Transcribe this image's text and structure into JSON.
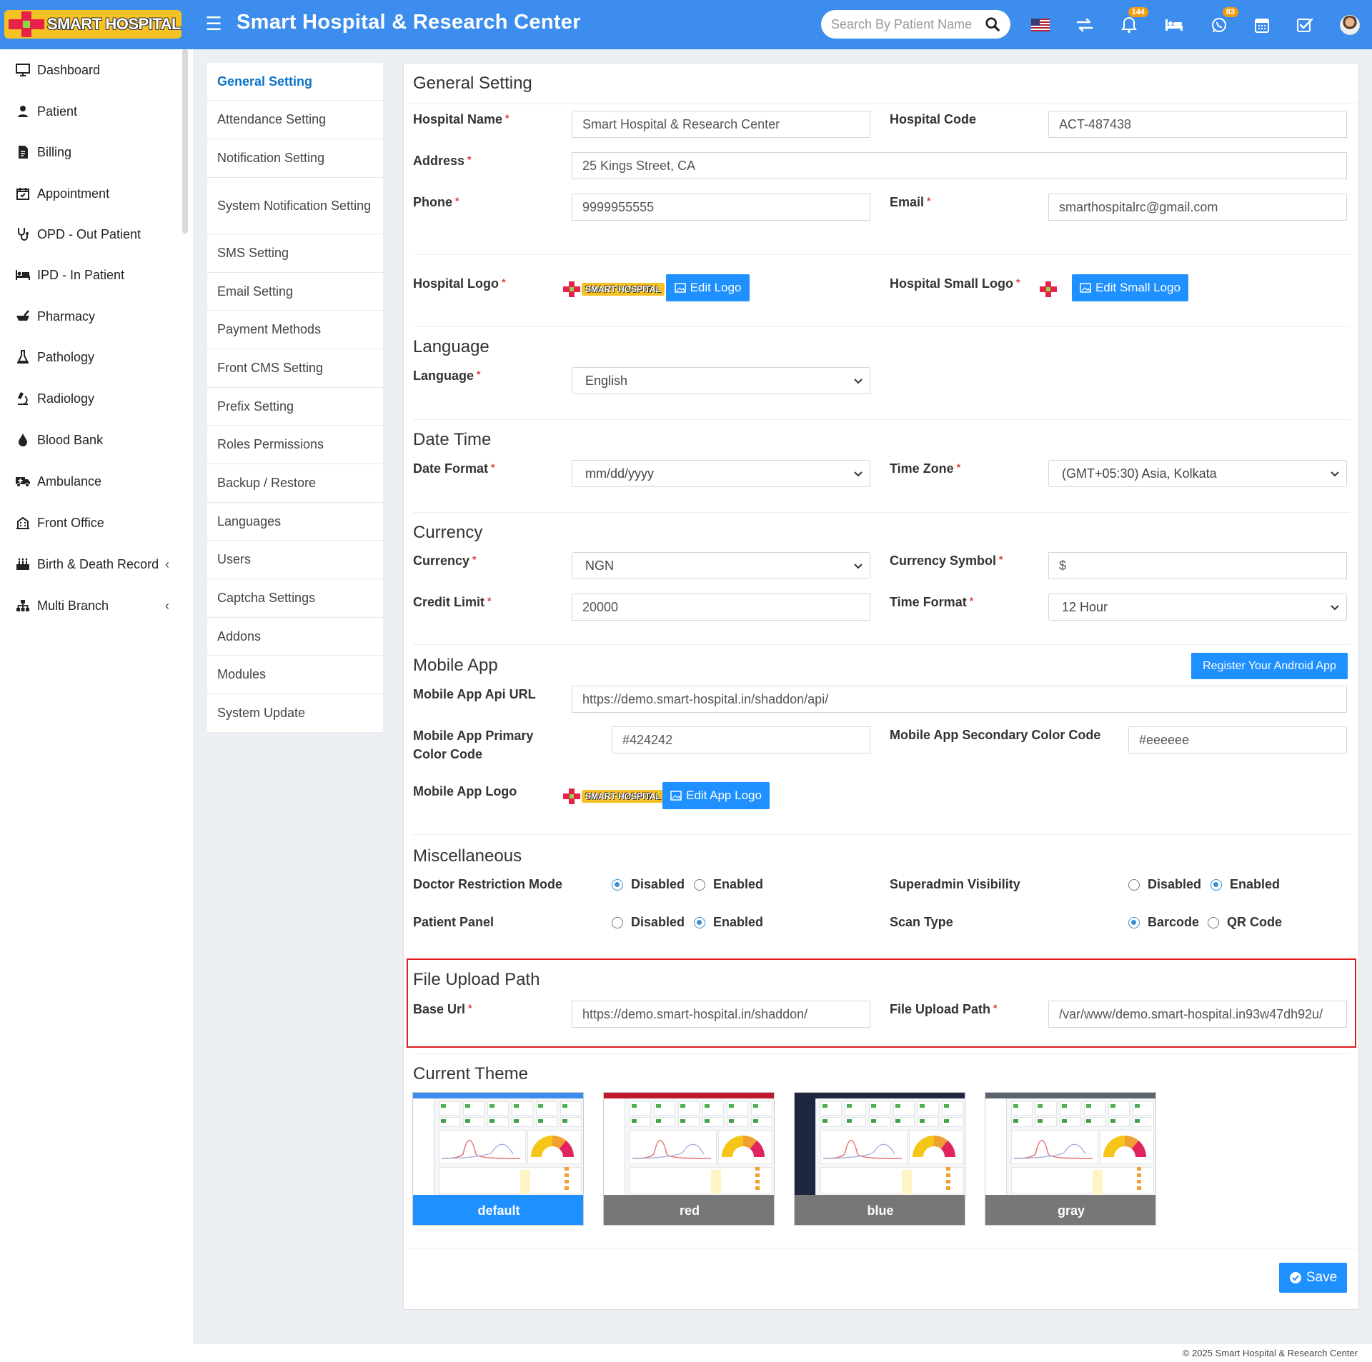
{
  "header": {
    "logo_text": "SMART HOSPITAL",
    "title": "Smart Hospital & Research Center",
    "search_placeholder": "Search By Patient Name",
    "notification_count": "144",
    "whatsapp_count": "83",
    "color": "#3c8dee"
  },
  "sidebar": {
    "items": [
      {
        "label": "Dashboard",
        "icon": "monitor-icon"
      },
      {
        "label": "Patient",
        "icon": "user-icon"
      },
      {
        "label": "Billing",
        "icon": "invoice-icon"
      },
      {
        "label": "Appointment",
        "icon": "calendar-check-icon"
      },
      {
        "label": "OPD - Out Patient",
        "icon": "stethoscope-icon"
      },
      {
        "label": "IPD - In Patient",
        "icon": "bed-icon"
      },
      {
        "label": "Pharmacy",
        "icon": "mortar-pestle-icon"
      },
      {
        "label": "Pathology",
        "icon": "flask-icon"
      },
      {
        "label": "Radiology",
        "icon": "microscope-icon"
      },
      {
        "label": "Blood Bank",
        "icon": "blood-drop-icon"
      },
      {
        "label": "Ambulance",
        "icon": "ambulance-icon"
      },
      {
        "label": "Front Office",
        "icon": "building-icon"
      },
      {
        "label": "Birth & Death Record",
        "icon": "birthday-cake-icon"
      },
      {
        "label": "Multi Branch",
        "icon": "sitemap-icon"
      }
    ]
  },
  "settings_menu": [
    "General Setting",
    "Attendance Setting",
    "Notification Setting",
    "System Notification Setting",
    "SMS Setting",
    "Email Setting",
    "Payment Methods",
    "Front CMS Setting",
    "Prefix Setting",
    "Roles Permissions",
    "Backup / Restore",
    "Languages",
    "Users",
    "Captcha Settings",
    "Addons",
    "Modules",
    "System Update"
  ],
  "form": {
    "title": "General Setting",
    "hospital_name_label": "Hospital Name",
    "hospital_name": "Smart Hospital & Research Center",
    "hospital_code_label": "Hospital Code",
    "hospital_code": "ACT-487438",
    "address_label": "Address",
    "address": "25 Kings Street, CA",
    "phone_label": "Phone",
    "phone": "9999955555",
    "email_label": "Email",
    "email": "smarthospitalrc@gmail.com",
    "hospital_logo_label": "Hospital Logo",
    "edit_logo": "Edit Logo",
    "small_logo_label": "Hospital Small Logo",
    "edit_small_logo": "Edit Small Logo",
    "language_section": "Language",
    "language_label": "Language",
    "language": "English",
    "datetime_section": "Date Time",
    "date_format_label": "Date Format",
    "date_format": "mm/dd/yyyy",
    "time_zone_label": "Time Zone",
    "time_zone": "(GMT+05:30) Asia, Kolkata",
    "currency_section": "Currency",
    "currency_label": "Currency",
    "currency": "NGN",
    "currency_symbol_label": "Currency Symbol",
    "currency_symbol": "$",
    "credit_limit_label": "Credit Limit",
    "credit_limit": "20000",
    "time_format_label": "Time Format",
    "time_format": "12 Hour",
    "mobile_section": "Mobile App",
    "register_app": "Register Your Android App",
    "api_url_label": "Mobile App Api URL",
    "api_url": "https://demo.smart-hospital.in/shaddon/api/",
    "primary_color_label": "Mobile App Primary Color Code",
    "primary_color": "#424242",
    "secondary_color_label": "Mobile App Secondary Color Code",
    "secondary_color": "#eeeeee",
    "app_logo_label": "Mobile App Logo",
    "edit_app_logo": "Edit App Logo",
    "misc_section": "Miscellaneous",
    "doctor_restriction_label": "Doctor Restriction Mode",
    "superadmin_visibility_label": "Superadmin Visibility",
    "patient_panel_label": "Patient Panel",
    "scan_type_label": "Scan Type",
    "disabled": "Disabled",
    "enabled": "Enabled",
    "barcode": "Barcode",
    "qrcode": "QR Code",
    "file_upload_section": "File Upload Path",
    "base_url_label": "Base Url",
    "base_url": "https://demo.smart-hospital.in/shaddon/",
    "file_upload_label": "File Upload Path",
    "file_upload_path": "/var/www/demo.smart-hospital.in93w47dh92u/",
    "theme_section": "Current Theme",
    "themes": [
      {
        "name": "default",
        "bar": "#3c8dee",
        "label_bg": "#1e90ff"
      },
      {
        "name": "red",
        "bar": "#c0182c",
        "label_bg": "#777777"
      },
      {
        "name": "blue",
        "bar": "#1e2740",
        "label_bg": "#777777"
      },
      {
        "name": "gray",
        "bar": "#5a6370",
        "label_bg": "#777777"
      }
    ],
    "save": "Save"
  },
  "footer": "© 2025 Smart Hospital & Research Center"
}
